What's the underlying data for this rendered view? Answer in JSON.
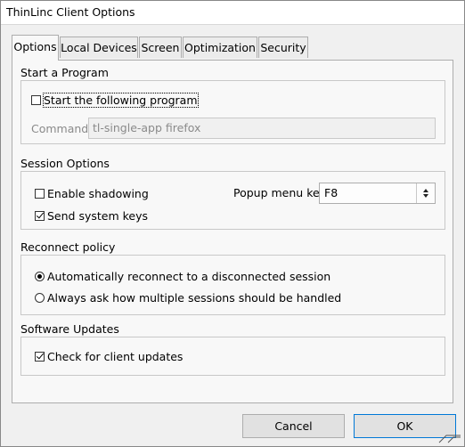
{
  "window": {
    "title": "ThinLinc Client Options"
  },
  "tabs": [
    {
      "label": "Options",
      "active": true
    },
    {
      "label": "Local Devices",
      "active": false
    },
    {
      "label": "Screen",
      "active": false
    },
    {
      "label": "Optimization",
      "active": false
    },
    {
      "label": "Security",
      "active": false
    }
  ],
  "start_program": {
    "section_label": "Start a Program",
    "checkbox_label": "Start the following program",
    "checked": false,
    "command_label": "Command:",
    "command_value": "tl-single-app firefox"
  },
  "session_options": {
    "section_label": "Session Options",
    "enable_shadowing_label": "Enable shadowing",
    "enable_shadowing_checked": false,
    "send_system_keys_label": "Send system keys",
    "send_system_keys_checked": true,
    "popup_menu_key_label": "Popup menu key",
    "popup_menu_key_value": "F8"
  },
  "reconnect_policy": {
    "section_label": "Reconnect policy",
    "options": [
      {
        "label": "Automatically reconnect to a disconnected session",
        "selected": true
      },
      {
        "label": "Always ask how multiple sessions should be handled",
        "selected": false
      }
    ]
  },
  "software_updates": {
    "section_label": "Software Updates",
    "check_updates_label": "Check for client updates",
    "check_updates_checked": true
  },
  "buttons": {
    "cancel_label": "Cancel",
    "ok_label": "OK"
  },
  "colors": {
    "default_button_border": "#0078d7",
    "panel_background": "#f8f8f8",
    "window_background": "#f0f0f0"
  }
}
